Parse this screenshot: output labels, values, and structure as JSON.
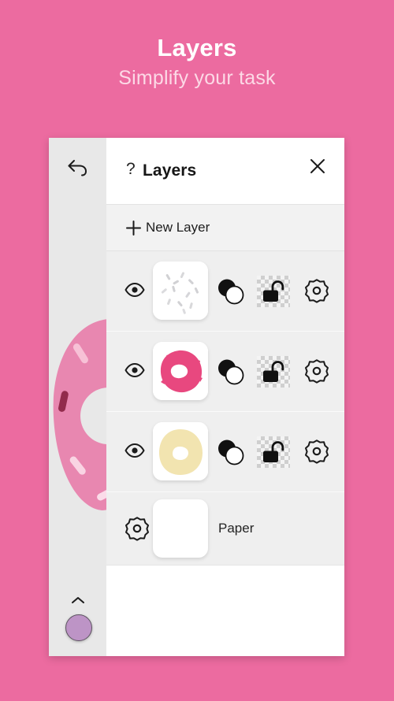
{
  "promo": {
    "title": "Layers",
    "subtitle": "Simplify your task",
    "background_color": "#ec6ba0",
    "title_color": "#ffffff",
    "subtitle_color": "#fcd9e6"
  },
  "canvas": {
    "undo_icon": "undo-arrow-icon",
    "chevron_icon": "chevron-up-icon",
    "color_swatch": {
      "name": "color-swatch",
      "color": "#bd94c6"
    },
    "artwork": "pink-donut-with-sprinkles",
    "background_color": "#e8e8e8"
  },
  "panel": {
    "help_glyph": "?",
    "title": "Layers",
    "close_glyph": "✕",
    "new_layer": {
      "label": "New Layer",
      "plus_glyph": "+"
    },
    "layers": [
      {
        "index": 1,
        "visible": true,
        "visibility_icon": "eye-icon",
        "thumbnail": "sprinkles-layer-thumbnail",
        "blend_icon": "blend-mode-icon",
        "lock_icon": "unlocked-padlock-icon",
        "locked": false,
        "settings_icon": "gear-icon"
      },
      {
        "index": 2,
        "visible": true,
        "visibility_icon": "eye-icon",
        "thumbnail": "pink-frosting-layer-thumbnail",
        "blend_icon": "blend-mode-icon",
        "lock_icon": "unlocked-padlock-icon",
        "locked": false,
        "settings_icon": "gear-icon"
      },
      {
        "index": 3,
        "visible": true,
        "visibility_icon": "eye-icon",
        "thumbnail": "dough-base-layer-thumbnail",
        "blend_icon": "blend-mode-icon",
        "lock_icon": "unlocked-padlock-icon",
        "locked": false,
        "settings_icon": "gear-icon"
      }
    ],
    "paper": {
      "label": "Paper",
      "settings_icon": "gear-icon",
      "thumbnail": "white-paper-thumbnail"
    }
  },
  "colors": {
    "frosting_pink": "#e8487f",
    "dough_cream": "#f2e4b0",
    "panel_row_bg": "#efefef",
    "panel_bg": "#ffffff"
  }
}
